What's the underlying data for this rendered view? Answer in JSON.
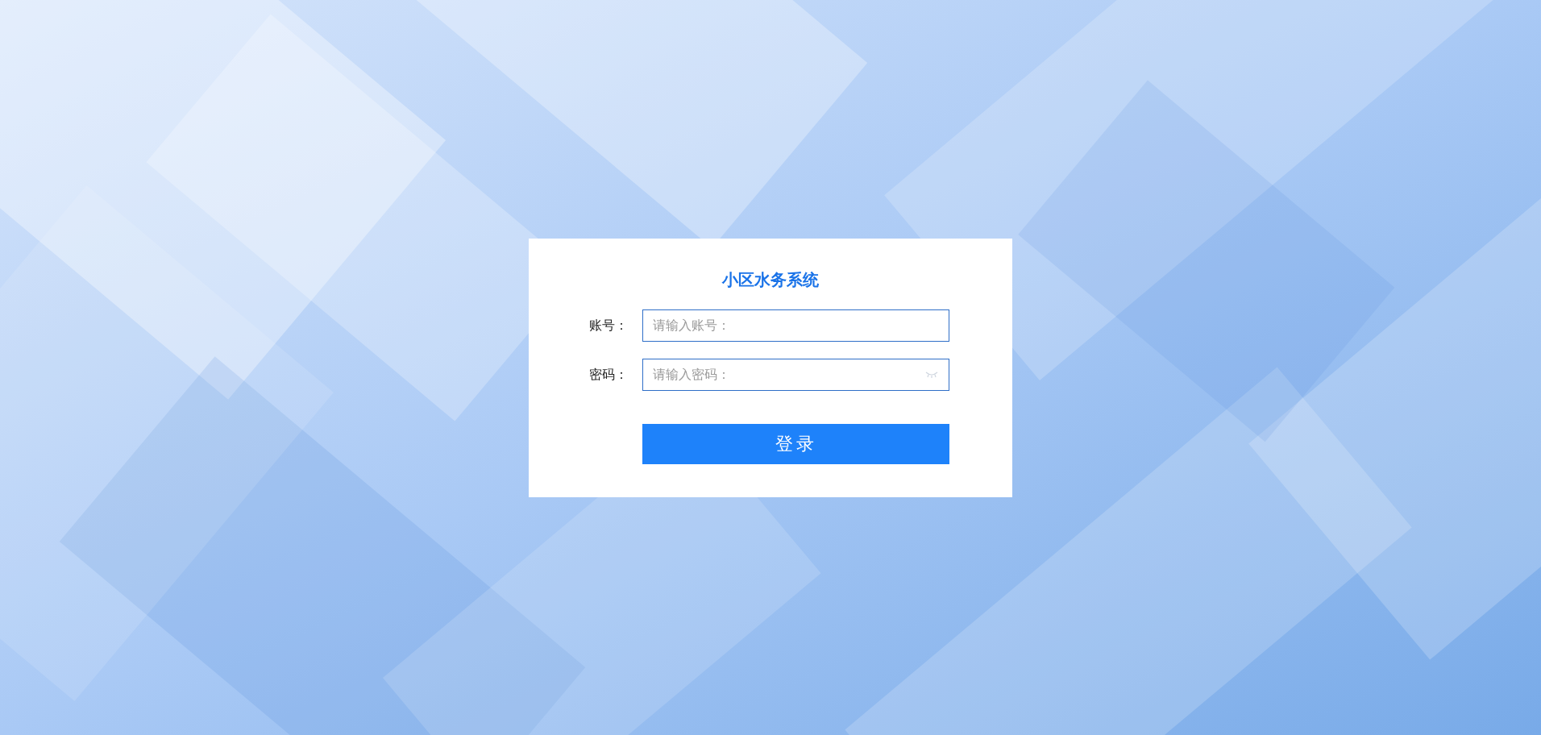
{
  "title": "小区水务系统",
  "fields": [
    {
      "kind": "text",
      "label": "账号：",
      "placeholder": "请输入账号："
    },
    {
      "kind": "password",
      "label": "密码：",
      "placeholder": "请输入密码："
    }
  ],
  "button": "登录"
}
